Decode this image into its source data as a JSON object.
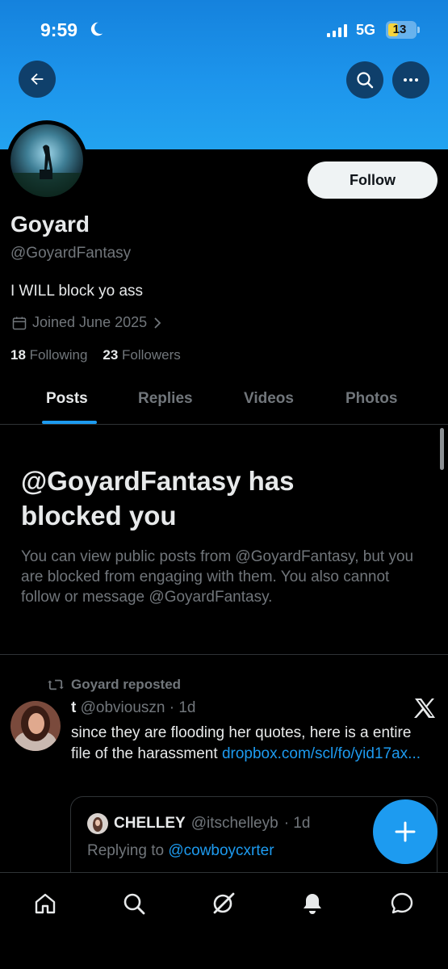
{
  "status_bar": {
    "time": "9:59",
    "network": "5G",
    "battery": "13"
  },
  "header": {
    "back_icon": "arrow-left-icon",
    "search_icon": "search-icon",
    "more_icon": "more-dots-icon"
  },
  "profile": {
    "name": "Goyard",
    "handle": "@GoyardFantasy",
    "bio": "I WILL block yo ass",
    "joined": "Joined June 2025",
    "following_count": "18",
    "following_label": "Following",
    "followers_count": "23",
    "followers_label": "Followers",
    "follow_button": "Follow"
  },
  "tabs": [
    {
      "label": "Posts",
      "active": true
    },
    {
      "label": "Replies",
      "active": false
    },
    {
      "label": "Videos",
      "active": false
    },
    {
      "label": "Photos",
      "active": false
    }
  ],
  "blocked": {
    "title": "@GoyardFantasy has blocked you",
    "body": "You can view public posts from @GoyardFantasy, but you are blocked from engaging with them. You also cannot follow or message @GoyardFantasy."
  },
  "post": {
    "repost_label": "Goyard reposted",
    "author_name": "t",
    "author_handle": "@obviouszn",
    "time": "· 1d",
    "text": "since they are flooding her quotes, here is a entire file of the harassment ",
    "link": "dropbox.com/scl/fo/yid17ax...",
    "quote": {
      "author_name": "CHELLEY",
      "author_handle": "@itschelleyb",
      "time": "· 1d",
      "replying_prefix": "Replying to ",
      "replying_to": "@cowboycxrter"
    }
  },
  "bottom_nav": [
    "home-icon",
    "search-icon",
    "grok-icon",
    "notifications-icon",
    "messages-icon"
  ],
  "colors": {
    "accent": "#1d9bf0",
    "banner": "#1d95ec",
    "background": "#000000",
    "muted": "#71767b"
  }
}
